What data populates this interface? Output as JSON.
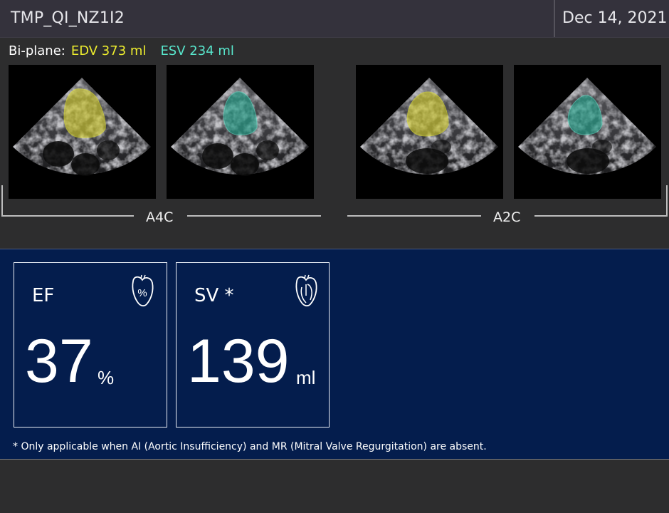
{
  "header": {
    "patient_id": "TMP_QI_NZ1I2",
    "date": "Dec 14, 2021"
  },
  "biplane": {
    "label": "Bi-plane:",
    "edv": "EDV 373 ml",
    "esv": "ESV 234 ml",
    "colors": {
      "edv": "#ecec2e",
      "esv": "#58e6cc"
    }
  },
  "views": [
    {
      "label": "A4C",
      "images": [
        "end-diastole",
        "end-systole"
      ]
    },
    {
      "label": "A2C",
      "images": [
        "end-diastole",
        "end-systole"
      ]
    }
  ],
  "metrics": [
    {
      "title": "EF",
      "value": "37",
      "unit": "%",
      "icon": "heart-percent-icon"
    },
    {
      "title": "SV *",
      "value": "139",
      "unit": "ml",
      "icon": "heart-chambers-icon"
    }
  ],
  "footnote": "* Only applicable when AI (Aortic Insufficiency) and MR (Mitral Valve Regurgitation) are absent."
}
